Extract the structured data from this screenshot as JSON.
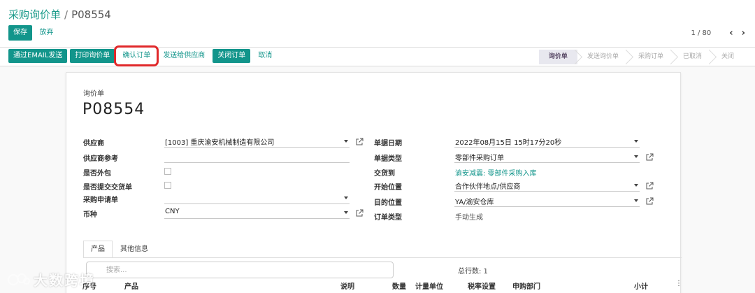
{
  "breadcrumb": {
    "parent": "采购询价单",
    "separator": "/",
    "current": "P08554"
  },
  "toolbar": {
    "save_label": "保存",
    "discard_label": "放弃"
  },
  "pager": {
    "value": "1 / 80"
  },
  "actions": [
    {
      "label": "通过EMAIL发送",
      "style": "primary"
    },
    {
      "label": "打印询价单",
      "style": "primary"
    },
    {
      "label": "确认订单",
      "style": "link",
      "highlighted": true
    },
    {
      "label": "发送给供应商",
      "style": "link"
    },
    {
      "label": "关闭订单",
      "style": "primary"
    },
    {
      "label": "取消",
      "style": "link"
    }
  ],
  "stages": [
    "询价单",
    "发送询价单",
    "采购订单",
    "已取消",
    "关闭"
  ],
  "active_stage": "询价单",
  "document": {
    "kind": "询价单",
    "name": "P08554"
  },
  "left_fields": {
    "vendor": {
      "label": "供应商",
      "value": "[1003] 重庆渝安机械制造有限公司"
    },
    "vendor_ref": {
      "label": "供应商参考",
      "value": ""
    },
    "outsourced": {
      "label": "是否外包",
      "checked": false
    },
    "submit_delivery": {
      "label": "是否提交交货单",
      "checked": false
    },
    "requisition": {
      "label": "采购申请单",
      "value": ""
    },
    "currency": {
      "label": "币种",
      "value": "CNY"
    }
  },
  "right_fields": {
    "order_date": {
      "label": "单据日期",
      "value": "2022年08月15日 15时17分20秒"
    },
    "order_type": {
      "label": "单据类型",
      "value": "零部件采购订单"
    },
    "deliver_to": {
      "label": "交货到",
      "value": "渝安减震: 零部件采购入库"
    },
    "source_location": {
      "label": "开始位置",
      "value": "合作伙伴地点/供应商"
    },
    "dest_location": {
      "label": "目的位置",
      "value": "YA/渝安仓库"
    },
    "order_category": {
      "label": "订单类型",
      "value": "手动生成"
    }
  },
  "tabs": [
    "产品",
    "其他信息"
  ],
  "active_tab": "产品",
  "search": {
    "placeholder": "搜索..."
  },
  "total": {
    "label": "总行数: 1"
  },
  "table_headers": [
    "序号",
    "产品",
    "说明",
    "数量",
    "计量单位",
    "税率设置",
    "申购部门",
    "小计"
  ],
  "watermark": {
    "text": "大数跨境"
  },
  "colors": {
    "accent": "#12958b",
    "highlight": "#e0282a"
  }
}
